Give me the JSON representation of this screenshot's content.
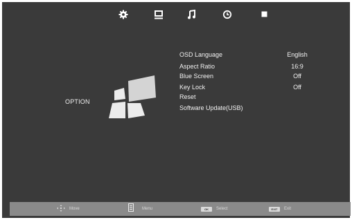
{
  "tabs": [
    {
      "icon": "gear-icon"
    },
    {
      "icon": "monitor-icon"
    },
    {
      "icon": "music-note-icon"
    },
    {
      "icon": "clock-icon"
    },
    {
      "icon": "square-icon"
    }
  ],
  "section": {
    "label": "OPTION"
  },
  "menu": [
    {
      "label": "OSD Language",
      "value": "English"
    },
    {
      "label": "Aspect Ratio",
      "value": "16:9"
    },
    {
      "label": "Blue Screen",
      "value": "Off"
    },
    {
      "label": "Key Lock",
      "value": "Off"
    },
    {
      "label": "Reset",
      "value": ""
    },
    {
      "label": "Software Update(USB)",
      "value": ""
    }
  ],
  "footer": {
    "move": {
      "icon": "dpad-icon",
      "label": "Move"
    },
    "menu": {
      "icon": "menu-icon",
      "label": "Menu"
    },
    "select": {
      "key": "OK",
      "label": "Select"
    },
    "exit": {
      "key": "EXIT",
      "label": "Exit"
    }
  },
  "colors": {
    "background": "#3a3a3a",
    "footer": "#8a8a8a",
    "text": "#f2f2f2"
  }
}
